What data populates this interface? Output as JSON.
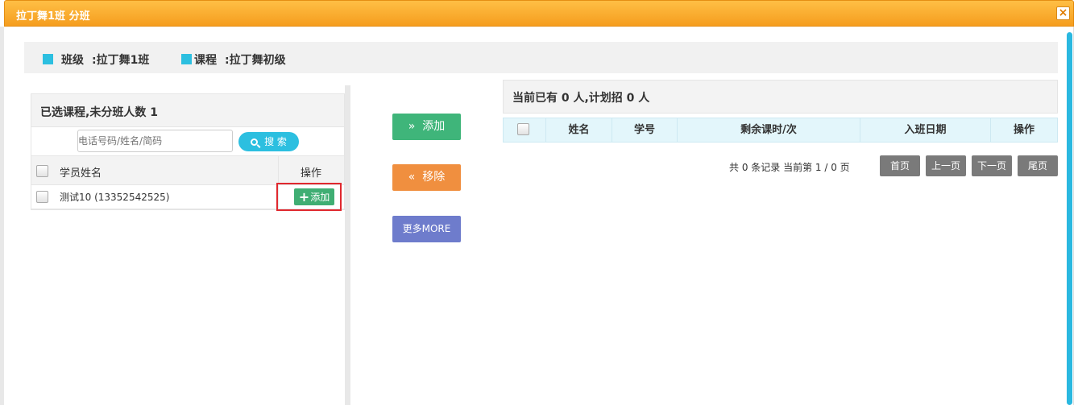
{
  "dialog": {
    "title": "拉丁舞1班 分班",
    "close_symbol": "×"
  },
  "info": {
    "class_label": "班级",
    "class_value": ":拉丁舞1班",
    "course_label": "课程",
    "course_value": ":拉丁舞初级"
  },
  "left_panel": {
    "header": "已选课程,未分班人数 1",
    "search_placeholder": "电话号码/姓名/简码",
    "search_button": "搜 索",
    "columns": {
      "name": "学员姓名",
      "operation": "操作"
    },
    "rows": [
      {
        "student": "测试10 (13352542525)",
        "action": "添加"
      }
    ]
  },
  "middle": {
    "add": "添加",
    "remove": "移除",
    "more": "更多MORE",
    "add_symbol": "»",
    "remove_symbol": "«"
  },
  "right_panel": {
    "header": "当前已有 0 人,计划招 0 人",
    "columns": [
      "姓名",
      "学号",
      "剩余课时/次",
      "入班日期",
      "操作"
    ],
    "pagination": {
      "summary": "共 0 条记录 当前第 1 / 0 页",
      "first": "首页",
      "prev": "上一页",
      "next": "下一页",
      "last": "尾页"
    }
  },
  "colors": {
    "title_bar": "#f5a623",
    "accent": "#2cbfe0",
    "add": "#3fb57a",
    "remove": "#f08f3f",
    "more": "#6e7ccc"
  }
}
